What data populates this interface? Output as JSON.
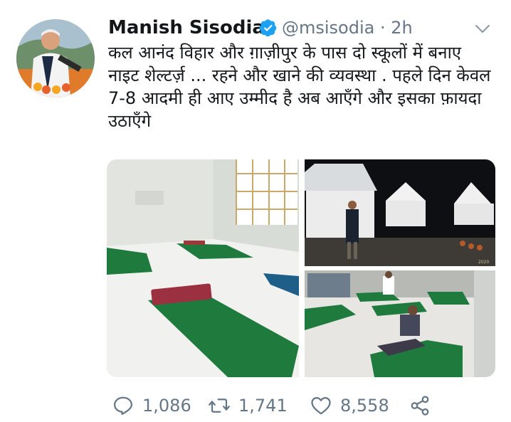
{
  "tweet": {
    "author_name": "Manish Sisodia",
    "handle": "@msisodia",
    "separator": "·",
    "time": "2h",
    "text": "कल आनंद विहार और ग़ाज़ीपुर के पास दो स्कूलों में बनाए नाइट शेल्टर्ज़ ... रहने और खाने की व्यवस्था . पहले दिन केवल 7-8 आदमी ही आए उम्मीद है अब आएँगे और इसका फ़ायदा उठाएँगे",
    "verified": true,
    "media_photo_count": 3,
    "photo_stamp": "2020"
  },
  "actions": {
    "reply_count": "1,086",
    "retweet_count": "1,741",
    "like_count": "8,558"
  },
  "icons": {
    "verified": "verified-badge-icon",
    "menu": "chevron-down-icon",
    "reply": "reply-icon",
    "retweet": "retweet-icon",
    "like": "heart-icon",
    "share": "share-icon"
  },
  "colors": {
    "text": "#14171a",
    "secondary": "#657786",
    "verified_blue": "#1da1f2"
  }
}
